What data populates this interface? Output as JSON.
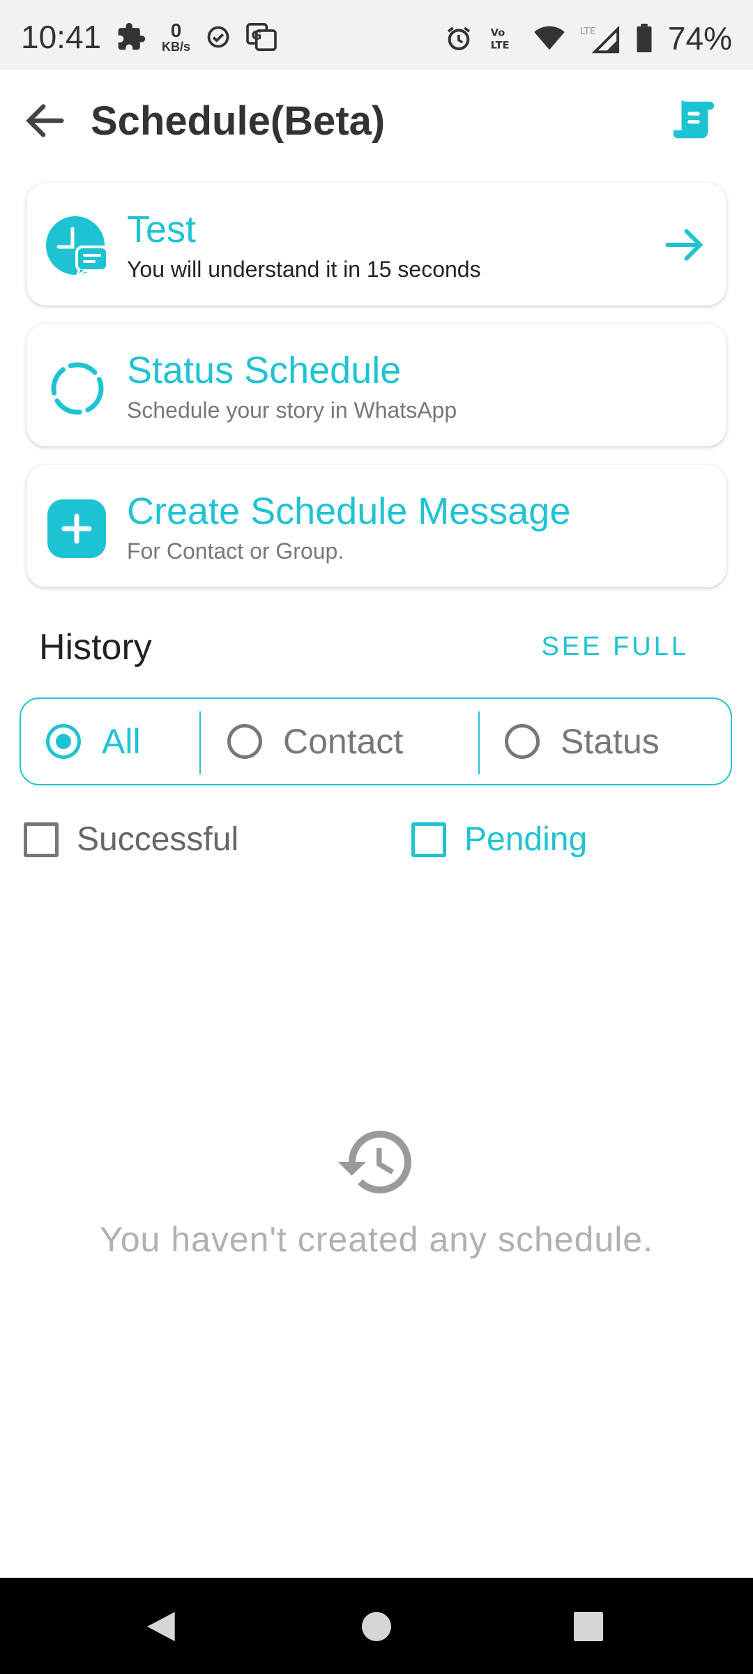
{
  "status_bar": {
    "time": "10:41",
    "net_speed_value": "0",
    "net_speed_unit": "KB/s",
    "battery": "74%",
    "icons": [
      "puzzle-icon",
      "check-circle-icon",
      "translate-icon",
      "alarm-icon",
      "volte-icon",
      "wifi-icon",
      "lte-signal-icon",
      "battery-icon"
    ]
  },
  "app_bar": {
    "title": "Schedule(Beta)",
    "back_icon": "arrow-back-icon",
    "action_icon": "document-icon"
  },
  "cards": [
    {
      "title": "Test",
      "subtitle": "You will understand it in 15 seconds",
      "icon": "schedule-chat-icon",
      "trailing_icon": "arrow-right-icon"
    },
    {
      "title": "Status Schedule",
      "subtitle": "Schedule your story in WhatsApp",
      "icon": "status-ring-icon"
    },
    {
      "title": "Create Schedule Message",
      "subtitle": "For Contact or Group.",
      "icon": "plus-icon"
    }
  ],
  "history": {
    "title": "History",
    "see_full": "SEE FULL",
    "filters": [
      {
        "label": "All",
        "selected": true
      },
      {
        "label": "Contact",
        "selected": false
      },
      {
        "label": "Status",
        "selected": false
      }
    ],
    "checkboxes": [
      {
        "label": "Successful",
        "checked": false
      },
      {
        "label": "Pending",
        "checked": false
      }
    ]
  },
  "empty_state": {
    "icon": "history-icon",
    "text": "You haven't created any schedule."
  },
  "colors": {
    "accent": "#1ec3d3",
    "text_dark": "#222222",
    "text_muted": "#777777",
    "empty_text": "#b0b0b0",
    "status_bar_bg": "#f2f2f2",
    "nav_bar_bg": "#000000"
  }
}
